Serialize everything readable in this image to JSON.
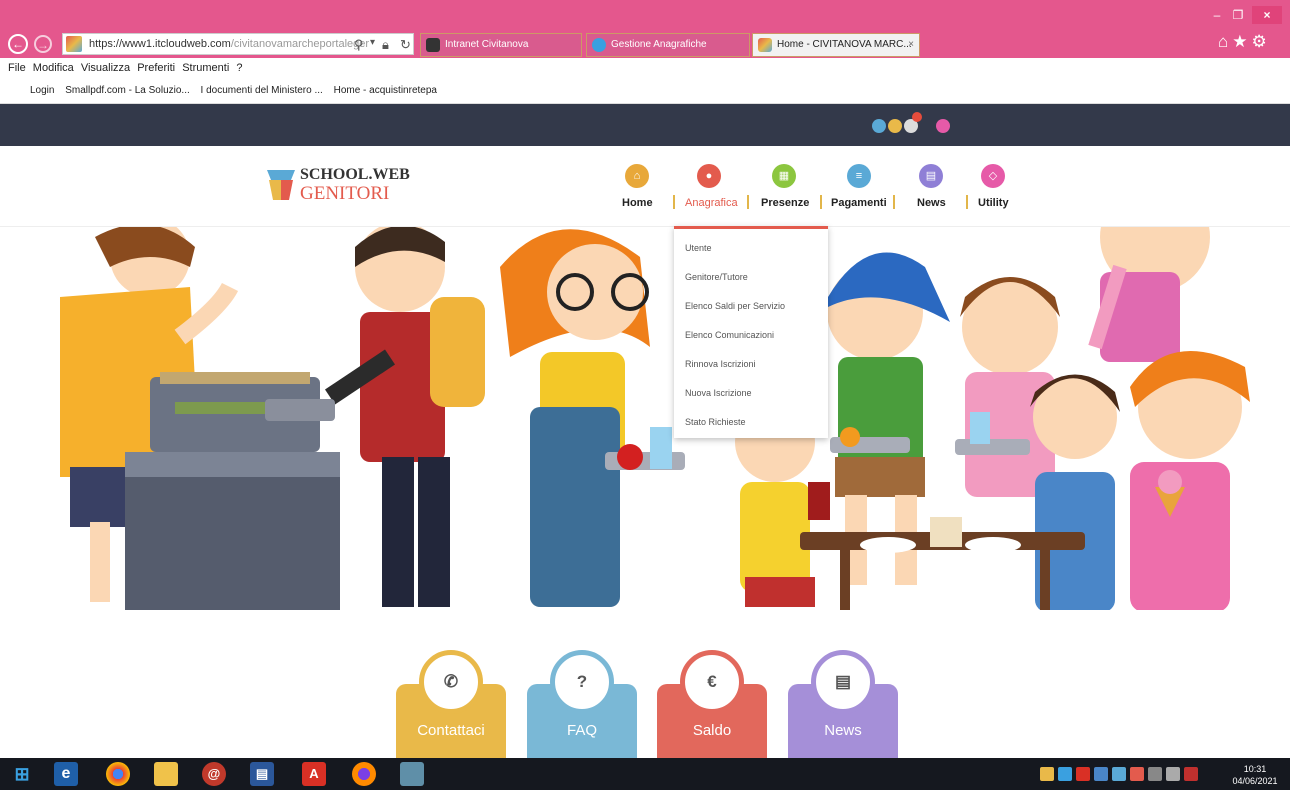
{
  "browser": {
    "url_main": "https://www1.itcloudweb.com",
    "url_rest": "/civitanovamarcheportaleger",
    "tabs": [
      {
        "label": "Intranet Civitanova",
        "active": false
      },
      {
        "label": "Gestione Anagrafiche",
        "active": false
      },
      {
        "label": "Home - CIVITANOVA MARC...",
        "active": true
      }
    ],
    "tab_close": "×",
    "window": {
      "minimize": "–",
      "maximize": "❐",
      "close": "×"
    },
    "menu": [
      "File",
      "Modifica",
      "Visualizza",
      "Preferiti",
      "Strumenti",
      "?"
    ],
    "favorites": [
      "Login",
      "Smallpdf.com - La Soluzio...",
      "I documenti del Ministero ...",
      "Home - acquistinretepa"
    ]
  },
  "site": {
    "logo_line1": "SCHOOL.WEB",
    "logo_line2": "GENITORI",
    "nav": [
      {
        "label": "Home",
        "color": "#e8a83a",
        "icon": "home-icon",
        "glyph": "⌂"
      },
      {
        "label": "Anagrafica",
        "color": "#e35b4d",
        "icon": "user-icon",
        "glyph": "●",
        "active": true
      },
      {
        "label": "Presenze",
        "color": "#8cc63f",
        "icon": "calendar-icon",
        "glyph": "▦"
      },
      {
        "label": "Pagamenti",
        "color": "#5aa9d6",
        "icon": "list-icon",
        "glyph": "≡"
      },
      {
        "label": "News",
        "color": "#8f7fd6",
        "icon": "newspaper-icon",
        "glyph": "▤"
      },
      {
        "label": "Utility",
        "color": "#e65aa8",
        "icon": "code-icon",
        "glyph": "◇"
      }
    ],
    "dropdown": [
      "Utente",
      "Genitore/Tutore",
      "Elenco Saldi per Servizio",
      "Elenco Comunicazioni",
      "Rinnova Iscrizioni",
      "Nuova Iscrizione",
      "Stato Richieste"
    ],
    "cards": [
      {
        "label": "Contattaci",
        "color": "#e9b949",
        "icon": "phone-icon",
        "glyph": "✆"
      },
      {
        "label": "FAQ",
        "color": "#7ab8d6",
        "icon": "question-icon",
        "glyph": "?"
      },
      {
        "label": "Saldo",
        "color": "#e2685c",
        "icon": "euro-icon",
        "glyph": "€"
      },
      {
        "label": "News",
        "color": "#a58fd8",
        "icon": "newspaper-icon",
        "glyph": "▤"
      }
    ]
  },
  "taskbar": {
    "time": "10:31",
    "date": "04/06/2021"
  }
}
